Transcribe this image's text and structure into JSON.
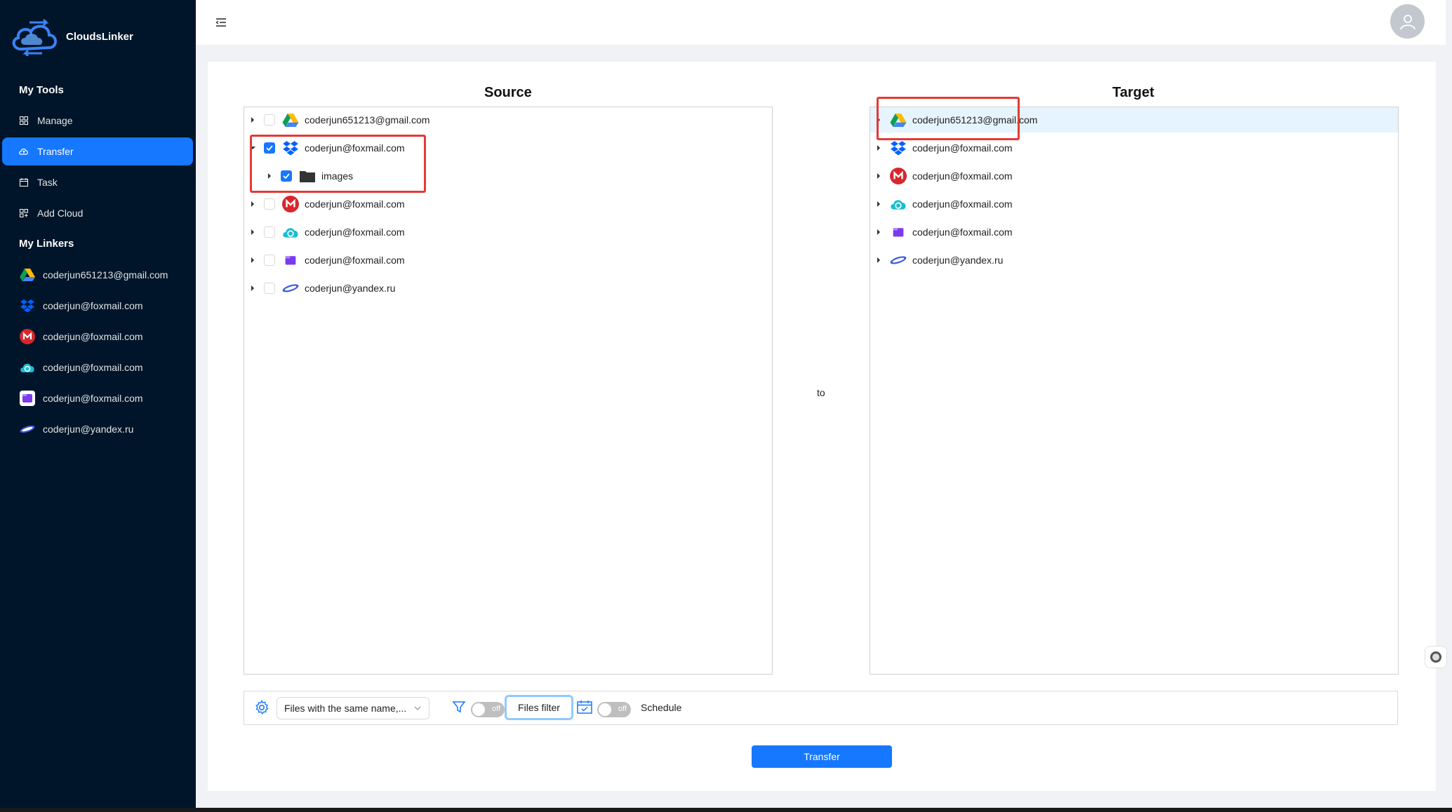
{
  "app": {
    "name": "CloudsLinker"
  },
  "sidebar": {
    "tools_title": "My Tools",
    "tools": [
      {
        "label": "Manage",
        "icon": "grid-icon"
      },
      {
        "label": "Transfer",
        "icon": "cloud-transfer-icon",
        "active": true
      },
      {
        "label": "Task",
        "icon": "calendar-icon"
      },
      {
        "label": "Add Cloud",
        "icon": "add-grid-icon"
      }
    ],
    "linkers_title": "My Linkers",
    "linkers": [
      {
        "label": "coderjun651213@gmail.com",
        "icon": "google-drive-icon"
      },
      {
        "label": "coderjun@foxmail.com",
        "icon": "dropbox-icon"
      },
      {
        "label": "coderjun@foxmail.com",
        "icon": "mega-icon"
      },
      {
        "label": "coderjun@foxmail.com",
        "icon": "pcloud-icon"
      },
      {
        "label": "coderjun@foxmail.com",
        "icon": "purple-folder-icon"
      },
      {
        "label": "coderjun@yandex.ru",
        "icon": "yandex-disk-icon"
      }
    ]
  },
  "source": {
    "title": "Source",
    "rows": [
      {
        "label": "coderjun651213@gmail.com",
        "icon": "google-drive-icon",
        "checked": false,
        "expanded": false
      },
      {
        "label": "coderjun@foxmail.com",
        "icon": "dropbox-icon",
        "checked": true,
        "expanded": true
      },
      {
        "label": "images",
        "icon": "folder-icon",
        "checked": true,
        "expanded": false,
        "child": true
      },
      {
        "label": "coderjun@foxmail.com",
        "icon": "mega-icon",
        "checked": false,
        "expanded": false
      },
      {
        "label": "coderjun@foxmail.com",
        "icon": "pcloud-icon",
        "checked": false,
        "expanded": false
      },
      {
        "label": "coderjun@foxmail.com",
        "icon": "purple-folder-icon",
        "checked": false,
        "expanded": false
      },
      {
        "label": "coderjun@yandex.ru",
        "icon": "yandex-disk-icon",
        "checked": false,
        "expanded": false
      }
    ]
  },
  "to_label": "to",
  "target": {
    "title": "Target",
    "rows": [
      {
        "label": "coderjun651213@gmail.com",
        "icon": "google-drive-icon",
        "selected": true
      },
      {
        "label": "coderjun@foxmail.com",
        "icon": "dropbox-icon"
      },
      {
        "label": "coderjun@foxmail.com",
        "icon": "mega-icon"
      },
      {
        "label": "coderjun@foxmail.com",
        "icon": "pcloud-icon"
      },
      {
        "label": "coderjun@foxmail.com",
        "icon": "purple-folder-icon"
      },
      {
        "label": "coderjun@yandex.ru",
        "icon": "yandex-disk-icon"
      }
    ]
  },
  "options": {
    "conflict_select": "Files with the same name,...",
    "filter_switch": "off",
    "files_filter_label": "Files filter",
    "schedule_switch": "off",
    "schedule_label": "Schedule"
  },
  "transfer_button": "Transfer",
  "colors": {
    "sidebar_bg": "#001529",
    "accent": "#1677ff",
    "highlight_box": "#e53935",
    "selected_row": "#e6f4ff"
  }
}
